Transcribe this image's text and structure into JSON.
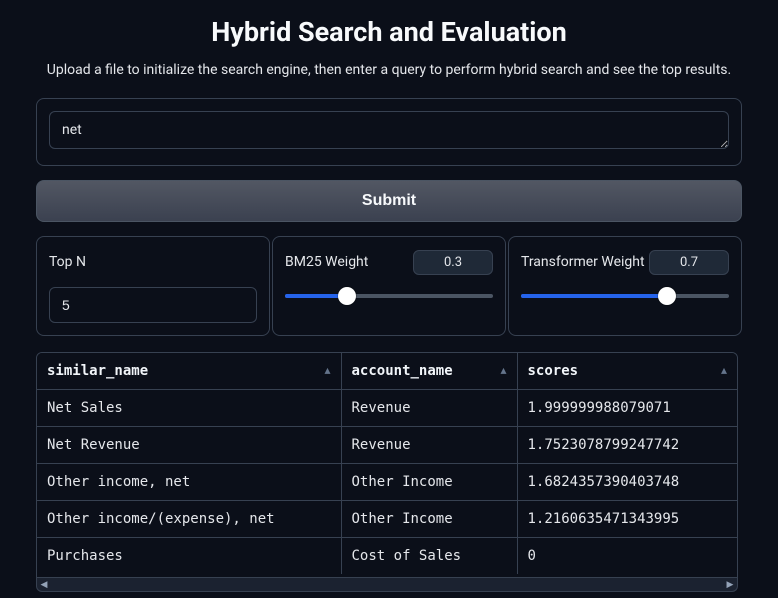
{
  "title": "Hybrid Search and Evaluation",
  "subtitle": "Upload a file to initialize the search engine, then enter a query to perform hybrid search and see the top results.",
  "query": {
    "value": "net"
  },
  "submit_label": "Submit",
  "controls": {
    "topn": {
      "label": "Top N",
      "value": "5"
    },
    "bm25": {
      "label": "BM25 Weight",
      "value": "0.3",
      "percent": 30
    },
    "transformer": {
      "label": "Transformer Weight",
      "value": "0.7",
      "percent": 70
    }
  },
  "table": {
    "columns": [
      "similar_name",
      "account_name",
      "scores"
    ],
    "rows": [
      {
        "similar_name": "Net Sales",
        "account_name": "Revenue",
        "scores": "1.999999988079071"
      },
      {
        "similar_name": "Net Revenue",
        "account_name": "Revenue",
        "scores": "1.7523078799247742"
      },
      {
        "similar_name": "Other income, net",
        "account_name": "Other Income",
        "scores": "1.6824357390403748"
      },
      {
        "similar_name": "Other income/(expense), net",
        "account_name": "Other Income",
        "scores": "1.2160635471343995"
      },
      {
        "similar_name": "Purchases",
        "account_name": "Cost of Sales",
        "scores": "0"
      }
    ]
  }
}
